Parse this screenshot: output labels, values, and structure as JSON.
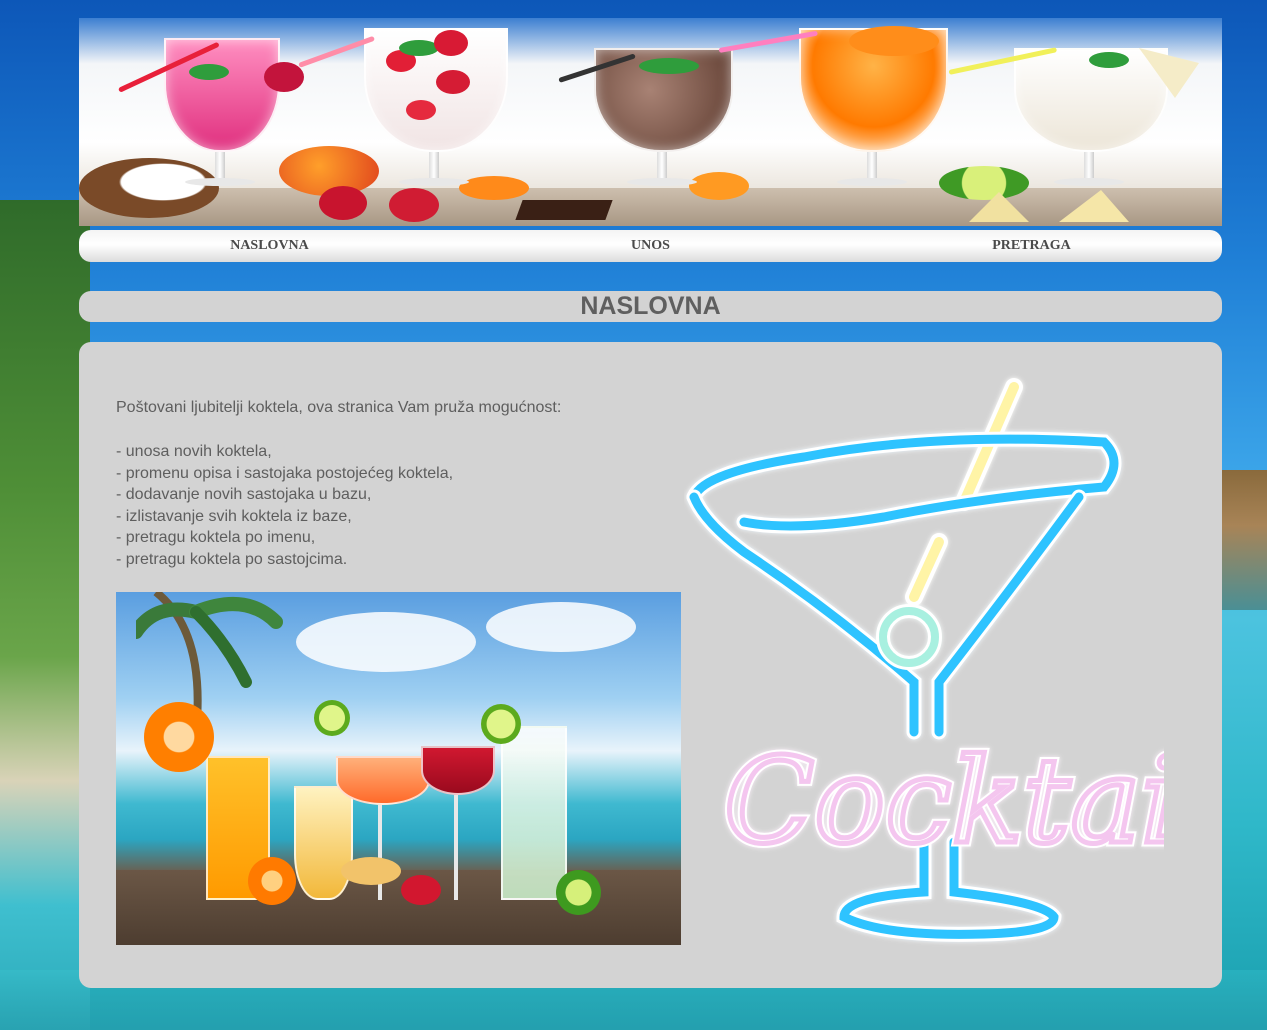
{
  "nav": {
    "items": [
      "NASLOVNA",
      "UNOS",
      "PRETRAGA"
    ]
  },
  "page": {
    "title": "NASLOVNA"
  },
  "content": {
    "intro": "Poštovani ljubitelji koktela, ova stranica Vam pruža mogućnost:",
    "features": [
      "- unosa novih koktela,",
      "- promenu opisa i sastojaka postojećeg koktela,",
      "- dodavanje novih sastojaka u bazu,",
      "- izlistavanje svih koktela iz baze,",
      "- pretragu koktela po imenu,",
      "- pretragu koktela po sastojcima."
    ],
    "neon_sign_text": "Cocktails"
  },
  "colors": {
    "panel": "#d3d3d3",
    "text": "#5e5e5e",
    "neon_blue": "#2ec3ff",
    "neon_pink": "#f4c6ef",
    "neon_yellow": "#fff8a8"
  },
  "icons": {
    "banner": "cocktail-banner-image",
    "photo": "beach-cocktails-photo",
    "neon": "neon-martini-glass-icon"
  }
}
